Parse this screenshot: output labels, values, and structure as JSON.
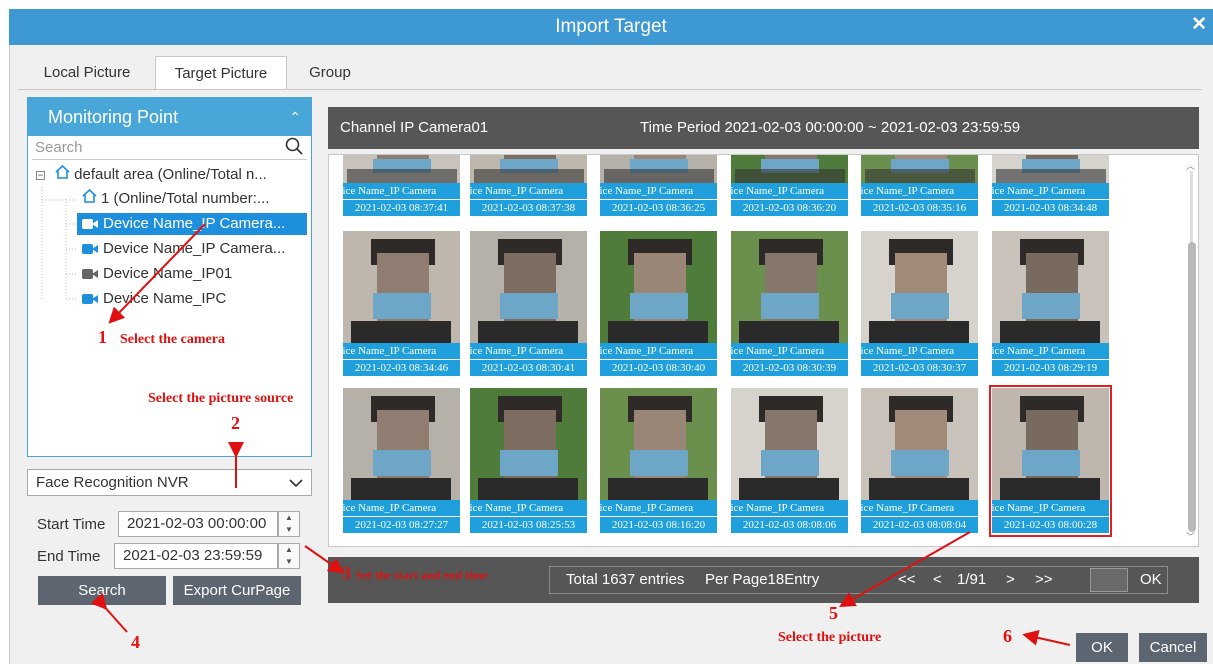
{
  "window": {
    "title": "Import Target"
  },
  "tabs": [
    {
      "label": "Local Picture"
    },
    {
      "label": "Target Picture"
    },
    {
      "label": "Group"
    }
  ],
  "tree": {
    "header": "Monitoring Point",
    "search_placeholder": "Search",
    "items": [
      {
        "label": "default area (Online/Total n..."
      },
      {
        "label": "1 (Online/Total number:..."
      },
      {
        "label": "Device Name_IP Camera..."
      },
      {
        "label": "Device Name_IP Camera..."
      },
      {
        "label": "Device Name_IP01"
      },
      {
        "label": "Device Name_IPC"
      }
    ]
  },
  "source_select": {
    "value": "Face Recognition NVR"
  },
  "time": {
    "start_label": "Start Time",
    "start_value": "2021-02-03 00:00:00",
    "end_label": "End Time",
    "end_value": "2021-02-03 23:59:59"
  },
  "buttons": {
    "search": "Search",
    "export": "Export CurPage",
    "ok": "OK",
    "cancel": "Cancel"
  },
  "result_header": {
    "channel": "Channel IP Camera01",
    "period": "Time Period 2021-02-03 00:00:00 ~ 2021-02-03 23:59:59"
  },
  "thumbnails": [
    {
      "name": "vice Name_IP Camera",
      "time": "2021-02-03 08:37:41"
    },
    {
      "name": "vice Name_IP Camera",
      "time": "2021-02-03 08:37:38"
    },
    {
      "name": "vice Name_IP Camera",
      "time": "2021-02-03 08:36:25"
    },
    {
      "name": "vice Name_IP Camera",
      "time": "2021-02-03 08:36:20"
    },
    {
      "name": "vice Name_IP Camera",
      "time": "2021-02-03 08:35:16"
    },
    {
      "name": "vice Name_IP Camera",
      "time": "2021-02-03 08:34:48"
    },
    {
      "name": "vice Name_IP Camera",
      "time": "2021-02-03 08:34:46"
    },
    {
      "name": "vice Name_IP Camera",
      "time": "2021-02-03 08:30:41"
    },
    {
      "name": "vice Name_IP Camera",
      "time": "2021-02-03 08:30:40"
    },
    {
      "name": "vice Name_IP Camera",
      "time": "2021-02-03 08:30:39"
    },
    {
      "name": "vice Name_IP Camera",
      "time": "2021-02-03 08:30:37"
    },
    {
      "name": "vice Name_IP Camera",
      "time": "2021-02-03 08:29:19"
    },
    {
      "name": "vice Name_IP Camera",
      "time": "2021-02-03 08:27:27"
    },
    {
      "name": "vice Name_IP Camera",
      "time": "2021-02-03 08:25:53"
    },
    {
      "name": "vice Name_IP Camera",
      "time": "2021-02-03 08:16:20"
    },
    {
      "name": "vice Name_IP Camera",
      "time": "2021-02-03 08:08:06"
    },
    {
      "name": "vice Name_IP Camera",
      "time": "2021-02-03 08:08:04"
    },
    {
      "name": "vice Name_IP Camera",
      "time": "2021-02-03 08:00:28"
    }
  ],
  "pager": {
    "total": "Total 1637 entries",
    "per_page": "Per Page18Entry",
    "first": "<<",
    "prev": "<",
    "page": "1/91",
    "next": ">",
    "last": ">>",
    "ok": "OK"
  },
  "annotations": {
    "n1": "1",
    "t1": "Select the camera",
    "t2": "Select the picture source",
    "n2": "2",
    "n3": "3",
    "t3": "Set the start and end time",
    "n4": "4",
    "n5": "5",
    "t5": "Select the picture",
    "n6": "6"
  },
  "colors": {
    "title_bar": "#3d98d3",
    "selection": "#1e8fdc",
    "dark_panel": "#565656",
    "button": "#5d6570",
    "annotation": "#e01010"
  }
}
